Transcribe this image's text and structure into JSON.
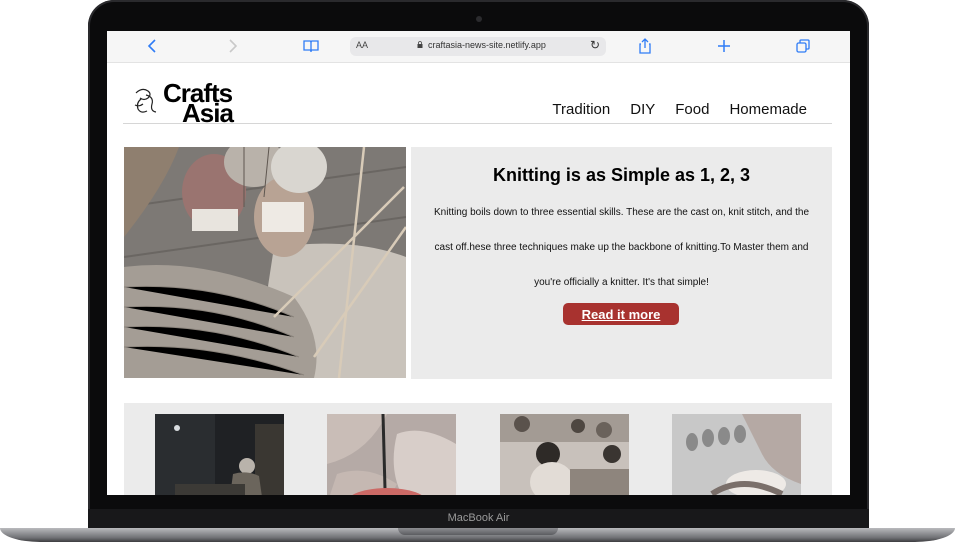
{
  "device": {
    "model_label": "MacBook Air"
  },
  "browser": {
    "text_size_label": "AA",
    "url": "craftasia-news-site.netlify.app",
    "icons": [
      "back-icon",
      "forward-icon",
      "book-icon",
      "lock-icon",
      "reload-icon",
      "share-icon",
      "plus-icon",
      "tabs-icon"
    ]
  },
  "site": {
    "logo": {
      "line1": "Crafts",
      "line2": "Asia"
    },
    "nav": [
      "Tradition",
      "DIY",
      "Food",
      "Homemade"
    ]
  },
  "hero": {
    "title": "Knitting is as Simple as 1, 2, 3",
    "body": "Knitting boils down to three essential skills. These are the cast on, knit stitch, and the cast off.hese three techniques make up the backbone of knitting.To Master them and you're officially a knitter. It's that simple!",
    "button": "Read it more"
  },
  "colors": {
    "accent": "#a8322f",
    "link": "#2f7cf6",
    "panel": "#ebebeb"
  }
}
